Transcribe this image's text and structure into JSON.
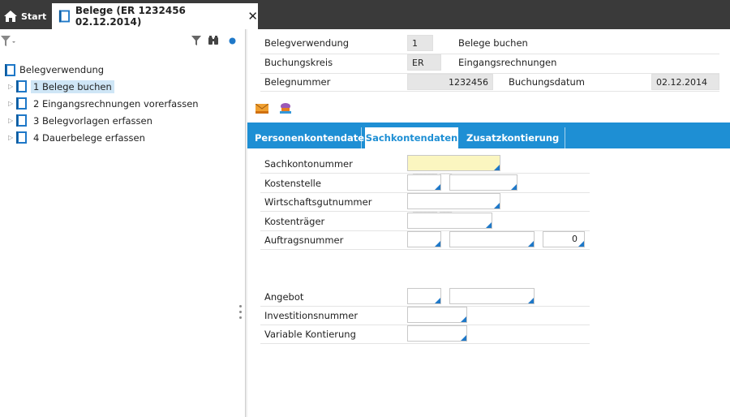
{
  "topbar": {
    "start_label": "Start",
    "doc_tab_label": "Belege (ER 1232456 02.12.2014)",
    "close_symbol": "✕"
  },
  "left": {
    "tree_root": "Belegverwendung",
    "items": [
      {
        "label": "1 Belege buchen",
        "selected": true
      },
      {
        "label": "2 Eingangsrechnungen vorerfassen",
        "selected": false
      },
      {
        "label": "3 Belegvorlagen erfassen",
        "selected": false
      },
      {
        "label": "4 Dauerbelege erfassen",
        "selected": false
      }
    ]
  },
  "header": {
    "belegverwendung_label": "Belegverwendung",
    "belegverwendung_value": "1",
    "belegverwendung_text": "Belege buchen",
    "buchungskreis_label": "Buchungskreis",
    "buchungskreis_value": "ER",
    "buchungskreis_text": "Eingangsrechnungen",
    "belegnummer_label": "Belegnummer",
    "belegnummer_value": "1232456",
    "buchungsdatum_label": "Buchungsdatum",
    "buchungsdatum_value": "02.12.2014"
  },
  "tabs": {
    "personen": "Personenkontendaten",
    "sach": "Sachkontendaten",
    "zusatz": "Zusatzkontierung"
  },
  "form": {
    "sachkontonummer_label": "Sachkontonummer",
    "sachkontonummer_mask": "______ ___",
    "kostenstelle_label": "Kostenstelle",
    "wirtschaftsgut_label": "Wirtschaftsgutnummer",
    "wirtschaftsgut_mask": "______ ___",
    "kostentraeger_label": "Kostenträger",
    "auftragsnummer_label": "Auftragsnummer",
    "auftragsnummer_value": "0",
    "angebot_label": "Angebot",
    "investitions_label": "Investitionsnummer",
    "variable_label": "Variable Kontierung"
  },
  "colors": {
    "accent": "#1e8fd4",
    "topbar": "#3a3a3a",
    "required_field": "#fbf6c0"
  }
}
